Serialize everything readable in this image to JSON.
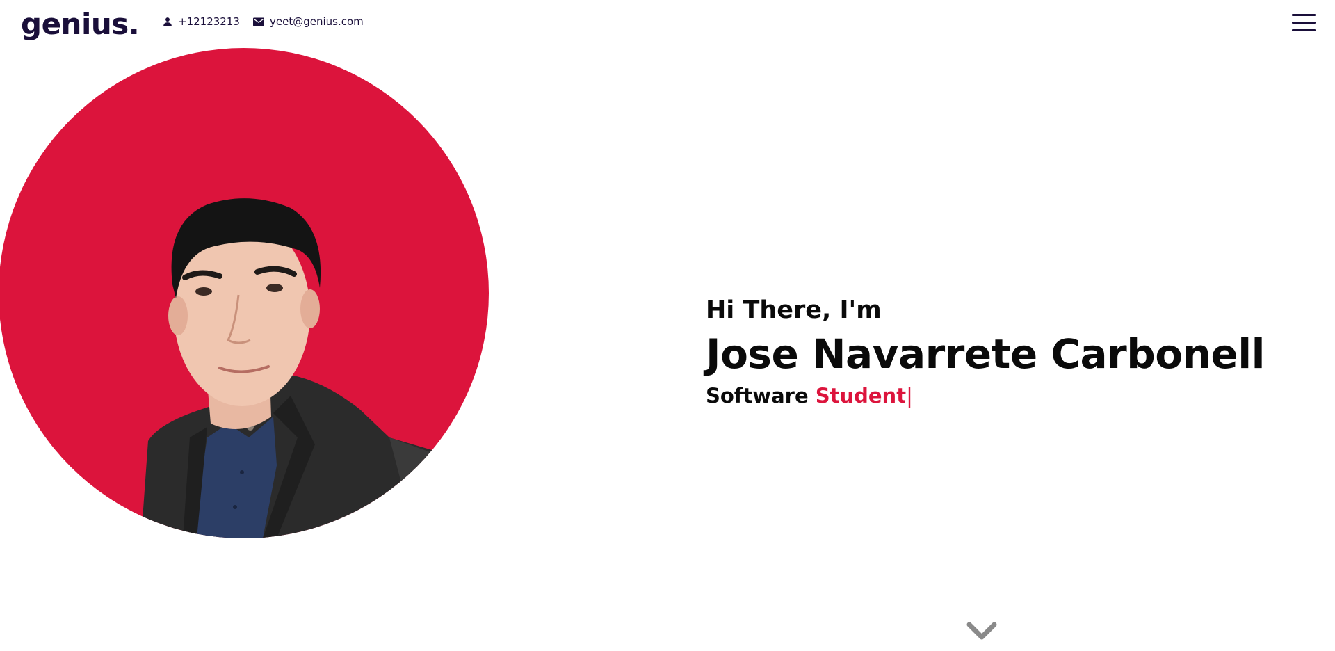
{
  "header": {
    "logo": "genius.",
    "phone": "+12123213",
    "email": "yeet@genius.com",
    "menu_icon": "hamburger-menu-icon",
    "phone_icon": "person-icon",
    "email_icon": "envelope-icon"
  },
  "hero": {
    "greeting": "Hi There, I'm",
    "name": "Jose Navarrete Carbonell",
    "role_prefix": "Software",
    "role_highlight": "Student",
    "cursor": "|",
    "photo_icon": "profile-photo",
    "scroll_icon": "chevron-down-icon"
  },
  "colors": {
    "accent": "#dc143c",
    "brand_dark": "#1a0f3a",
    "text": "#0a0a0a",
    "chevron": "#8a8a8a"
  }
}
